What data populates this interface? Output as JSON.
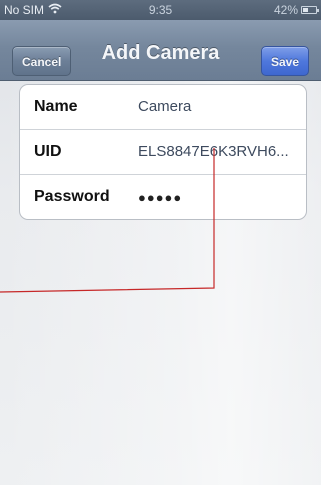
{
  "status_bar": {
    "carrier": "No SIM",
    "time": "9:35",
    "battery": "42%",
    "battery_level": 0.42
  },
  "nav": {
    "title": "Add Camera",
    "cancel_label": "Cancel",
    "save_label": "Save"
  },
  "form": {
    "rows": [
      {
        "label": "Name",
        "value": "Camera"
      },
      {
        "label": "UID",
        "value": "ELS8847E6K3RVH6..."
      },
      {
        "label": "Password",
        "value": "●●●●●"
      }
    ]
  },
  "colors": {
    "nav_bar": "#75879d",
    "save_button": "#4f78dc",
    "annotation": "#c62828"
  },
  "icons": [
    "wifi-icon",
    "battery-icon"
  ]
}
